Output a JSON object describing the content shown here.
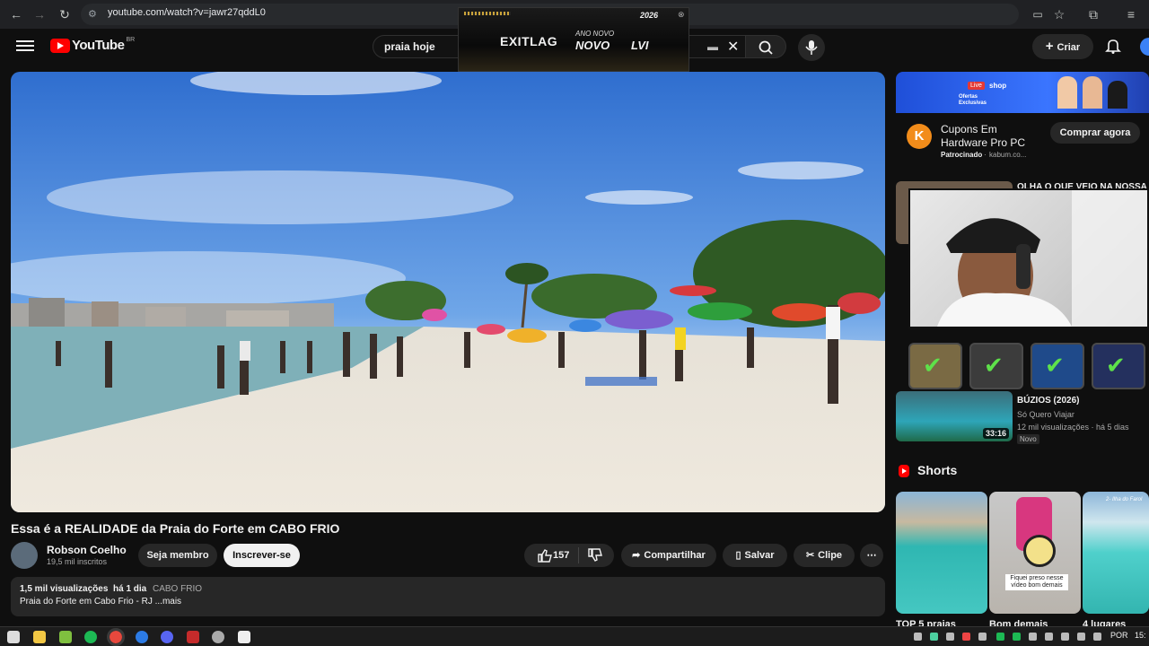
{
  "browser": {
    "url": "youtube.com/watch?v=jawr27qddL0"
  },
  "youtube": {
    "logo_text": "YouTube",
    "country_code": "BR",
    "search_query": "praia hoje",
    "create_label": "Criar"
  },
  "ad_banner": {
    "brand": "EXITLAG",
    "line1": "ANO NOVO",
    "line2": "NOVO",
    "line3": "LVI",
    "year_tag": "2026"
  },
  "video": {
    "title": "Essa é a REALIDADE da Praia do Forte em CABO FRIO",
    "channel": "Robson Coelho",
    "subscribers": "19,5 mil inscritos",
    "member_label": "Seja membro",
    "subscribe_label": "Inscrever-se",
    "likes": "157",
    "share_label": "Compartilhar",
    "save_label": "Salvar",
    "clip_label": "Clipe",
    "views": "1,5 mil visualizações",
    "age": "há 1 dia",
    "hashtag": "CABO FRIO",
    "description": "Praia do Forte em Cabo Frio - RJ ...mais"
  },
  "sidebar": {
    "ad": {
      "title_line1": "Cupons Em",
      "title_line2": "Hardware Pro PC",
      "sponsored": "Patrocinado",
      "domain": "kabum.co...",
      "cta": "Comprar agora",
      "banner_live": "Live",
      "banner_shop": "shop",
      "banner_offers": "Ofertas Exclusivas"
    },
    "partial_title": "OLHA O QUE VEIO NA NOSSA",
    "recommended": {
      "title": "BÚZIOS (2026)",
      "channel": "Só Quero Viajar",
      "meta": "12 mil visualizações · há 5 dias",
      "badge": "Novo",
      "duration": "33:16"
    },
    "shorts_header": "Shorts",
    "shorts": [
      {
        "title": "TOP 5 praias"
      },
      {
        "title": "Bom demais",
        "caption": "Fiquei preso nesse vídeo bom demais"
      },
      {
        "title": "4 lugares",
        "overlay": "2- Ilha do Farol"
      }
    ]
  },
  "taskbar": {
    "lang": "POR",
    "time": "15:"
  },
  "colors": {
    "background": "#0f0f0f",
    "surface": "#272727",
    "brand_red": "#ff0000",
    "text": "#f1f1f1",
    "muted": "#aaaaaa"
  }
}
